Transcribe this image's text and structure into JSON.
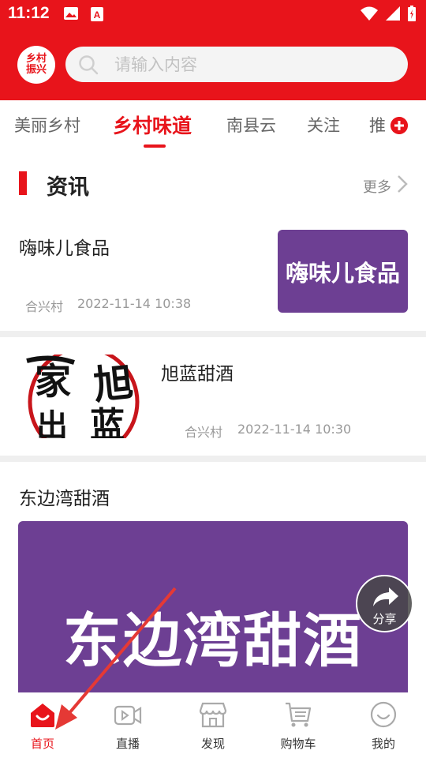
{
  "status_bar": {
    "time": "11:12"
  },
  "header": {
    "logo_text": "乡村振兴",
    "search_placeholder": "请输入内容"
  },
  "tabs": [
    {
      "label": "美丽乡村",
      "active": false
    },
    {
      "label": "乡村味道",
      "active": true
    },
    {
      "label": "南县云",
      "active": false
    },
    {
      "label": "关注",
      "active": false
    },
    {
      "label": "推",
      "active": false
    }
  ],
  "section": {
    "title": "资讯",
    "more_label": "更多"
  },
  "articles": [
    {
      "title": "嗨味儿食品",
      "source": "合兴村",
      "date": "2022-11-14 10:38",
      "thumb_text": "嗨味儿食品",
      "thumb_color": "#6d3f93"
    },
    {
      "title": "旭蓝甜酒",
      "source": "合兴村",
      "date": "2022-11-14 10:30",
      "thumb_text": "旭蓝"
    },
    {
      "title": "东边湾甜酒",
      "banner_text": "东边湾甜酒",
      "banner_color": "#6d3f93"
    }
  ],
  "share": {
    "label": "分享"
  },
  "bottom_nav": [
    {
      "label": "首页",
      "icon": "home-icon",
      "active": true
    },
    {
      "label": "直播",
      "icon": "video-icon",
      "active": false
    },
    {
      "label": "发现",
      "icon": "store-icon",
      "active": false
    },
    {
      "label": "购物车",
      "icon": "cart-icon",
      "active": false
    },
    {
      "label": "我的",
      "icon": "smile-icon",
      "active": false
    }
  ],
  "colors": {
    "brand_red": "#e8141b",
    "purple": "#6d3f93"
  }
}
